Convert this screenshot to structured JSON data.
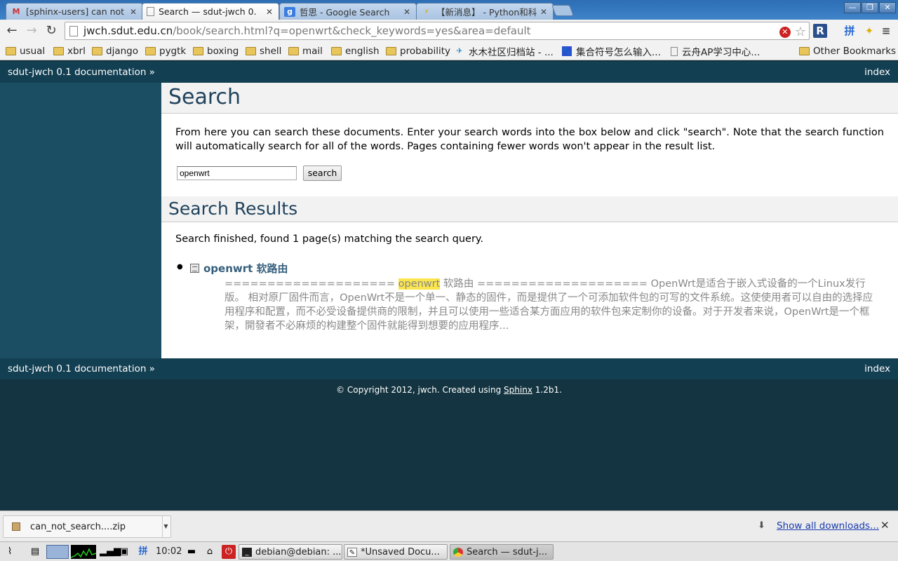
{
  "browser": {
    "tabs": [
      {
        "label": "[sphinx-users] can not",
        "favicon": "gmail-icon",
        "active": false
      },
      {
        "label": "Search — sdut-jwch 0.",
        "favicon": "page-icon",
        "active": true
      },
      {
        "label": "哲思 - Google Search",
        "favicon": "google-icon",
        "active": false
      },
      {
        "label": "【新消息】 - Python和科",
        "favicon": "lightning-icon",
        "active": false
      }
    ],
    "url_host": "jwch.sdut.edu.cn",
    "url_rest": "/book/search.html?q=openwrt&check_keywords=yes&area=default",
    "bookmarks": [
      "usual",
      "xbrl",
      "django",
      "pygtk",
      "boxing",
      "shell",
      "mail",
      "english",
      "probability",
      "水木社区归档站 - ...",
      "集合符号怎么输入...",
      "云舟AP学习中心..."
    ],
    "other_bookmarks": "Other Bookmarks"
  },
  "page": {
    "relbar_doc": "sdut-jwch 0.1 documentation »",
    "relbar_index": "index",
    "title": "Search",
    "intro": "From here you can search these documents. Enter your search words into the box below and click \"search\". Note that the search function will automatically search for all of the words. Pages containing fewer words won't appear in the result list.",
    "search_value": "openwrt",
    "search_button": "search",
    "results_heading": "Search Results",
    "results_status": "Search finished, found 1 page(s) matching the search query.",
    "result": {
      "title": "openwrt 软路由",
      "snippet_before": "==================== ",
      "snippet_highlight": "openwrt",
      "snippet_after": " 软路由 ==================== OpenWrt是适合于嵌入式设备的一个Linux发行版。 相对原厂固件而言，OpenWrt不是一个单一、静态的固件，而是提供了一个可添加软件包的可写的文件系统。这使使用者可以自由的选择应用程序和配置，而不必受设备提供商的限制，并且可以使用一些适合某方面应用的软件包来定制你的设备。对于开发者来说，OpenWrt是一个框架，開發者不必麻烦的构建整个固件就能得到想要的应用程序..."
    },
    "copyright_prefix": "© Copyright 2012, jwch. Created using ",
    "copyright_link": "Sphinx",
    "copyright_suffix": " 1.2b1."
  },
  "downloads": {
    "file": "can_not_search....zip",
    "show_all": "Show all downloads..."
  },
  "taskbar": {
    "clock": "10:02",
    "tasks": [
      "debian@debian: ...",
      "*Unsaved Docu...",
      "Search — sdut-j..."
    ]
  }
}
